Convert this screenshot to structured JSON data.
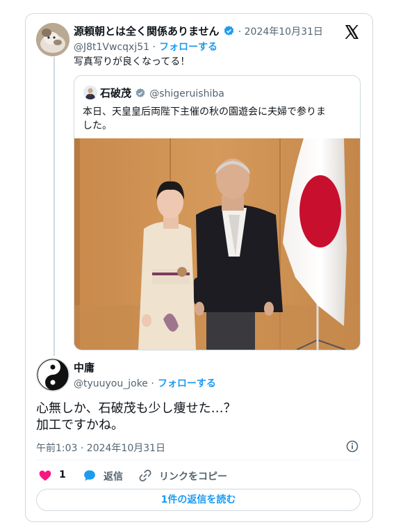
{
  "reply_to": {
    "display_name": "源頼朝とは全く関係ありません",
    "date": "· 2024年10月31日",
    "handle": "@J8t1Vwcqxj51 ·",
    "follow_label": "フォローする",
    "text": "写真写りが良くなってる！"
  },
  "quoted": {
    "display_name": "石破茂",
    "handle": "@shigeruishiba",
    "text_line1": "本日、天皇皇后両陛下主催の秋の園遊会に夫婦で参りま",
    "text_line2": "した。"
  },
  "main": {
    "display_name": "中庸",
    "handle": "@tyuuyou_joke ·",
    "follow_label": "フォローする",
    "text_line1": "心無しか、石破茂も少し痩せた…？",
    "text_line2": "加工ですかね。",
    "timestamp": "午前1:03 · 2024年10月31日"
  },
  "actions": {
    "like_count": "1",
    "reply_label": "返信",
    "copy_link_label": "リンクをコピー"
  },
  "read_replies_label": "1件の返信を読む",
  "colors": {
    "accent": "#1d9bf0",
    "like": "#f91880",
    "verified": "#1d9bf0",
    "border": "#cfd9de"
  },
  "icons": [
    "x-logo-icon",
    "verified-badge-icon",
    "heart-icon",
    "reply-bubble-icon",
    "link-icon",
    "info-icon"
  ]
}
